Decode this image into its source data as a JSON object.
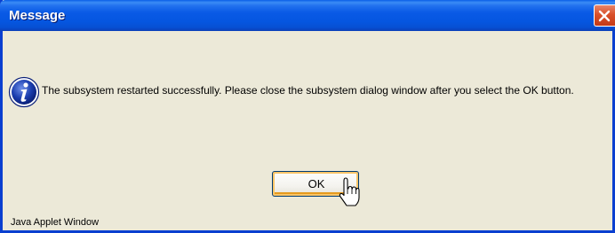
{
  "window": {
    "title": "Message",
    "status": "Java Applet Window"
  },
  "dialog": {
    "icon": "information-icon",
    "message": "The subsystem restarted successfully. Please close the subsystem dialog window after you select the OK button.",
    "ok_label": "OK"
  },
  "colors": {
    "title_bar": "#0a5ae6",
    "window_bg": "#ece9d8",
    "close_button": "#d9502a",
    "button_focus": "#f9c569"
  }
}
